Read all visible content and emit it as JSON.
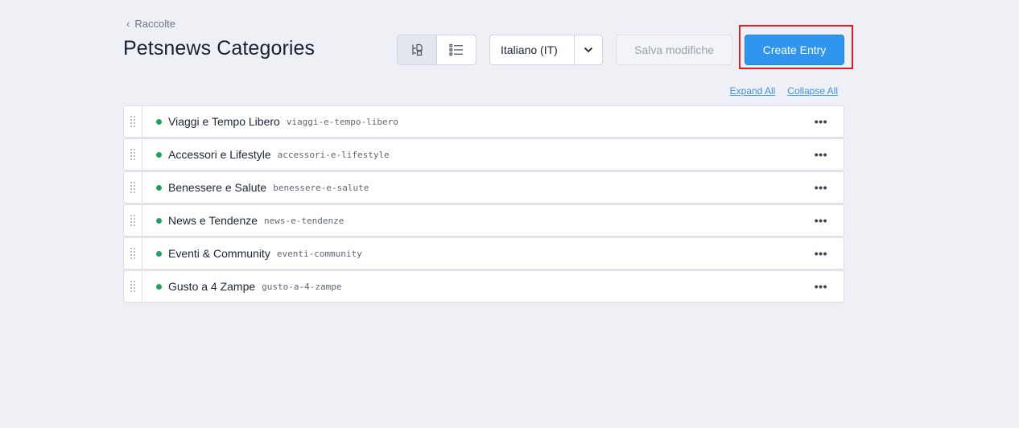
{
  "breadcrumb": {
    "label": "Raccolte"
  },
  "page": {
    "title": "Petsnews Categories"
  },
  "view_toggle": {
    "options": [
      "tree-view-icon",
      "list-view-icon"
    ],
    "selected": "tree-view-icon"
  },
  "locale": {
    "value": "Italiano (IT)"
  },
  "toolbar": {
    "save_label": "Salva modifiche",
    "create_label": "Create Entry"
  },
  "links": {
    "expand_all": "Expand All",
    "collapse_all": "Collapse All"
  },
  "colors": {
    "accent": "#2f95ee",
    "status_published": "#21a35b",
    "highlight": "#e01e1e"
  },
  "entries": [
    {
      "name": "Viaggi e Tempo Libero",
      "slug": "viaggi-e-tempo-libero"
    },
    {
      "name": "Accessori e Lifestyle",
      "slug": "accessori-e-lifestyle"
    },
    {
      "name": "Benessere e Salute",
      "slug": "benessere-e-salute"
    },
    {
      "name": "News e Tendenze",
      "slug": "news-e-tendenze"
    },
    {
      "name": "Eventi & Community",
      "slug": "eventi-community"
    },
    {
      "name": "Gusto a 4 Zampe",
      "slug": "gusto-a-4-zampe"
    }
  ],
  "entry_menu_glyph": "•••"
}
